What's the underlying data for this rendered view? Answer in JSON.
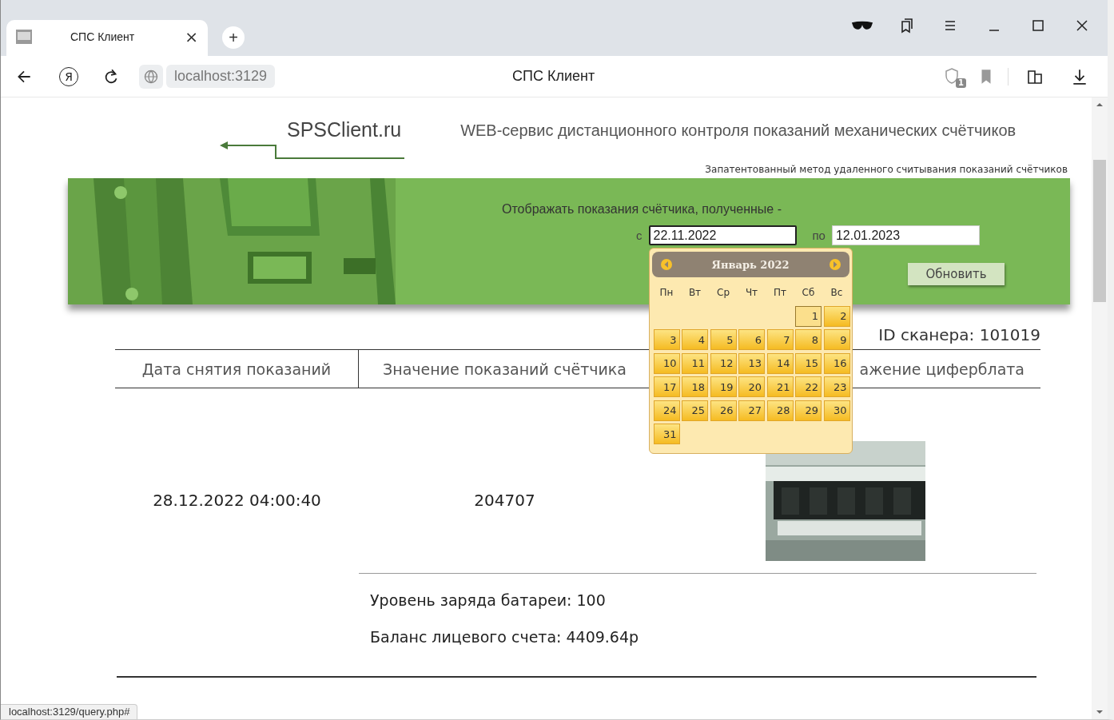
{
  "browser": {
    "tab": {
      "title": "СПС Клиент",
      "close": "×"
    },
    "new_tab": "+",
    "toolbar": {
      "yandex": "Я",
      "address": "localhost:3129",
      "page_title": "СПС Клиент",
      "shield_badge": "1"
    },
    "status_url": "localhost:3129/query.php#"
  },
  "header": {
    "logo": "SPSClient.ru",
    "tagline": "WEB-сервис дистанционного контроля показаний механических счётчиков",
    "note": "Запатентованный метод удаленного считывания показаний счётчиков"
  },
  "filter": {
    "prompt": "Отображать показания счётчика, полученные  -",
    "from_label": "с",
    "from_value": "22.11.2022",
    "from_focused": true,
    "to_label": "по",
    "to_value": "12.01.2023",
    "to_focused": false,
    "button": "Обновить"
  },
  "datepicker": {
    "month": "Январь 2022",
    "weekdays": [
      "Пн",
      "Вт",
      "Ср",
      "Чт",
      "Пт",
      "Сб",
      "Вс"
    ],
    "weeks": [
      [
        {
          "day": "1",
          "highlighted": true
        },
        {
          "day": "2",
          "highlighted": false
        }
      ],
      [
        {
          "day": "3",
          "highlighted": false
        },
        {
          "day": "4",
          "highlighted": false
        },
        {
          "day": "5",
          "highlighted": false
        },
        {
          "day": "6",
          "highlighted": false
        },
        {
          "day": "7",
          "highlighted": false
        },
        {
          "day": "8",
          "highlighted": false
        },
        {
          "day": "9",
          "highlighted": false
        }
      ],
      [
        {
          "day": "10",
          "highlighted": false
        },
        {
          "day": "11",
          "highlighted": false
        },
        {
          "day": "12",
          "highlighted": false
        },
        {
          "day": "13",
          "highlighted": false
        },
        {
          "day": "14",
          "highlighted": false
        },
        {
          "day": "15",
          "highlighted": false
        },
        {
          "day": "16",
          "highlighted": false
        }
      ],
      [
        {
          "day": "17",
          "highlighted": false
        },
        {
          "day": "18",
          "highlighted": false
        },
        {
          "day": "19",
          "highlighted": false
        },
        {
          "day": "20",
          "highlighted": false
        },
        {
          "day": "21",
          "highlighted": false
        },
        {
          "day": "22",
          "highlighted": false
        },
        {
          "day": "23",
          "highlighted": false
        }
      ],
      [
        {
          "day": "24",
          "highlighted": false
        },
        {
          "day": "25",
          "highlighted": false
        },
        {
          "day": "26",
          "highlighted": false
        },
        {
          "day": "27",
          "highlighted": false
        },
        {
          "day": "28",
          "highlighted": false
        },
        {
          "day": "29",
          "highlighted": false
        },
        {
          "day": "30",
          "highlighted": false
        }
      ],
      [
        {
          "day": "31",
          "highlighted": false
        }
      ]
    ]
  },
  "scanner_id": "ID сканера: 101019",
  "table": {
    "columns": [
      "Дата снятия показаний",
      "Значение показаний счётчика",
      "ажение циферблата"
    ],
    "rows": [
      {
        "date": "28.12.2022 04:00:40",
        "value": "204707"
      }
    ]
  },
  "battery": "Уровень заряда батареи: 100",
  "balance": "Баланс лицевого счета: 4409.64р"
}
